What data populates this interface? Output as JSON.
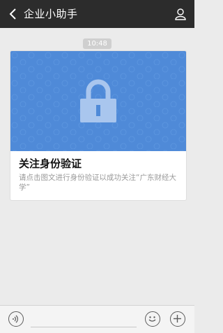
{
  "header": {
    "title": "企业小助手",
    "back_icon": "back-arrow-icon",
    "profile_icon": "person-icon"
  },
  "chat": {
    "timestamp": "10:48",
    "card": {
      "title": "关注身份验证",
      "description": "请点击图文进行身份验证以成功关注“广东财经大学”",
      "banner_icon": "lock-icon"
    }
  },
  "input_bar": {
    "voice_icon": "voice-icon",
    "emoji_icon": "emoji-icon",
    "more_icon": "plus-icon"
  },
  "colors": {
    "topbar": "#2c2c2c",
    "banner": "#4f8ad8",
    "background": "#ebebeb"
  }
}
